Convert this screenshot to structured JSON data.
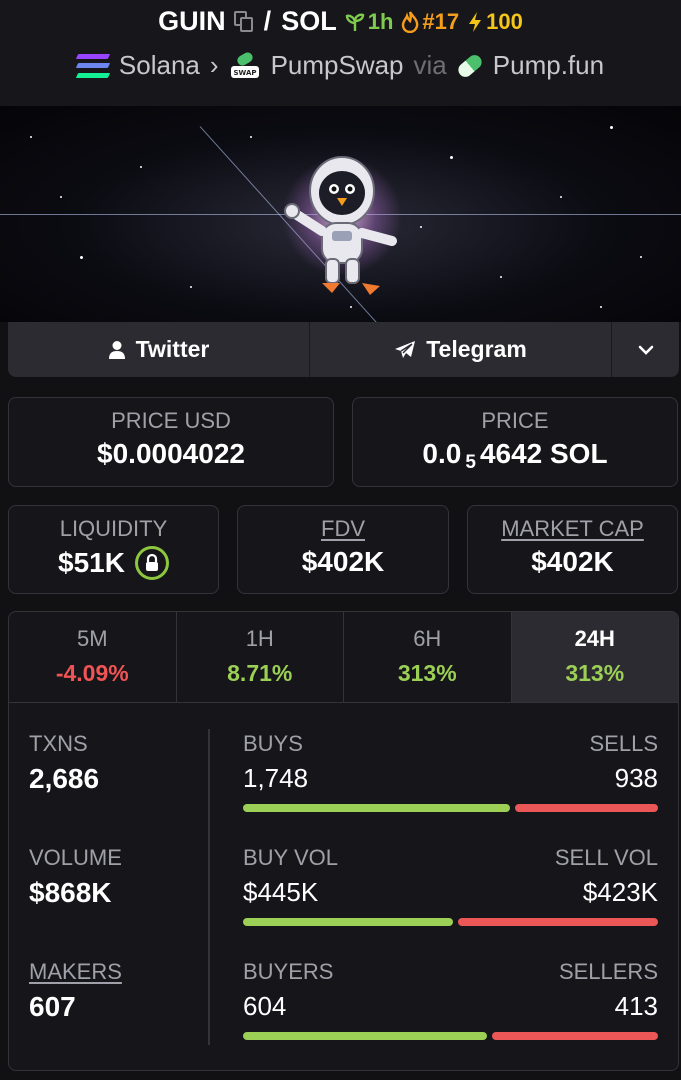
{
  "header": {
    "token": "GUIN",
    "slash": "/",
    "quote": "SOL",
    "age": "1h",
    "rank": "#17",
    "boosts": "100",
    "chain": "Solana",
    "dex": "PumpSwap",
    "via": "via",
    "launchpad": "Pump.fun"
  },
  "social": {
    "twitter": "Twitter",
    "telegram": "Telegram"
  },
  "price": {
    "usd_label": "PRICE USD",
    "usd_value": "$0.0004022",
    "native_label": "PRICE",
    "native_prefix": "0.0",
    "native_sub": "5",
    "native_rest": "4642 SOL"
  },
  "market": {
    "liquidity_label": "LIQUIDITY",
    "liquidity_value": "$51K",
    "fdv_label": "FDV",
    "fdv_value": "$402K",
    "mcap_label": "MARKET CAP",
    "mcap_value": "$402K"
  },
  "tabs": [
    {
      "label": "5M",
      "value": "-4.09%"
    },
    {
      "label": "1H",
      "value": "8.71%"
    },
    {
      "label": "6H",
      "value": "313%"
    },
    {
      "label": "24H",
      "value": "313%"
    }
  ],
  "metrics": {
    "txns_label": "TXNS",
    "txns_value": "2,686",
    "volume_label": "VOLUME",
    "volume_value": "$868K",
    "makers_label": "MAKERS",
    "makers_value": "607"
  },
  "ratios": {
    "buys_label": "BUYS",
    "buys_value": "1,748",
    "sells_label": "SELLS",
    "sells_value": "938",
    "buys_fraction": 0.651,
    "buyvol_label": "BUY VOL",
    "buyvol_value": "$445K",
    "sellvol_label": "SELL VOL",
    "sellvol_value": "$423K",
    "buyvol_fraction": 0.513,
    "buyers_label": "BUYERS",
    "buyers_value": "604",
    "sellers_label": "SELLERS",
    "sellers_value": "413",
    "buyers_fraction": 0.594
  },
  "colors": {
    "positive": "#9bcf55",
    "negative": "#f05454",
    "background": "#111114"
  },
  "icons": [
    "copy-icon",
    "sprout-icon",
    "flame-icon",
    "bolt-icon",
    "solana-logo-icon",
    "chevron-right-icon",
    "pumpswap-icon",
    "pill-icon",
    "user-icon",
    "telegram-plane-icon",
    "chevron-down-icon",
    "lock-icon"
  ]
}
